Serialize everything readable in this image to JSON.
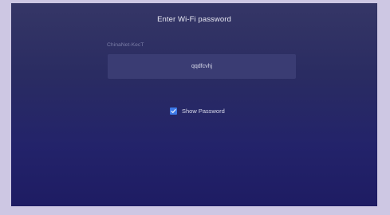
{
  "dialog": {
    "title": "Enter Wi-Fi password",
    "network_name": "ChinaNet-KecT",
    "password_value": "qqdfcvhj",
    "show_password": {
      "label": "Show Password",
      "checked": true,
      "icon": "check-icon"
    }
  },
  "colors": {
    "background_outer": "#cdc7e3",
    "dialog_top": "#353666",
    "dialog_bottom": "#1e1c63",
    "field_bg": "#3a3c73",
    "checkbox_accent": "#3d79e8"
  }
}
